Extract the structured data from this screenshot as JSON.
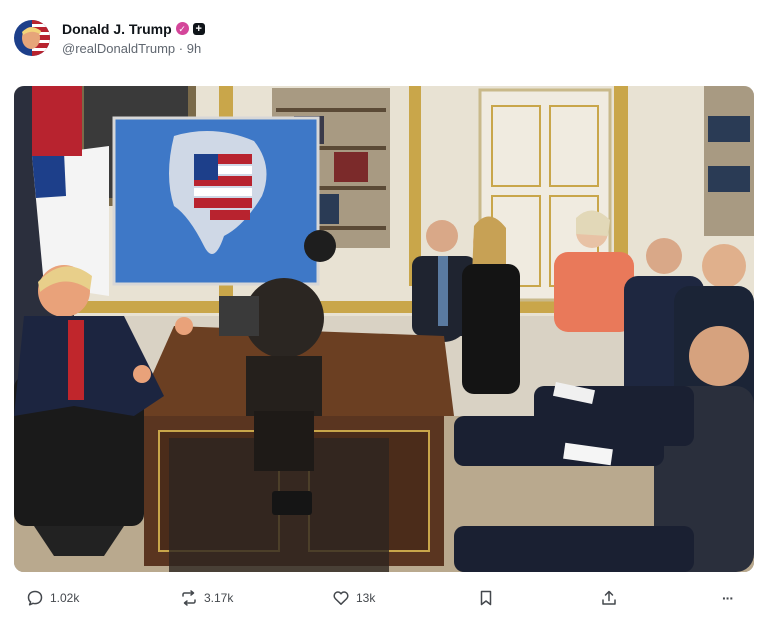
{
  "post": {
    "author": {
      "name": "Donald J. Trump",
      "handle": "@realDonaldTrump",
      "separator": "·",
      "time": "9h",
      "verified_icon": "check-badge-icon",
      "follow_icon": "plus-icon"
    },
    "media": {
      "kind": "photo"
    },
    "actions": {
      "reply": {
        "icon": "comment-icon",
        "count": "1.02k"
      },
      "repost": {
        "icon": "repost-icon",
        "count": "3.17k"
      },
      "like": {
        "icon": "heart-icon",
        "count": "13k"
      },
      "bookmark": {
        "icon": "bookmark-icon"
      },
      "share": {
        "icon": "share-icon"
      },
      "more": {
        "icon": "more-icon",
        "label": "···"
      }
    }
  },
  "colors": {
    "badge": "#d4469a",
    "muted": "#606770",
    "text": "#0f1419"
  }
}
